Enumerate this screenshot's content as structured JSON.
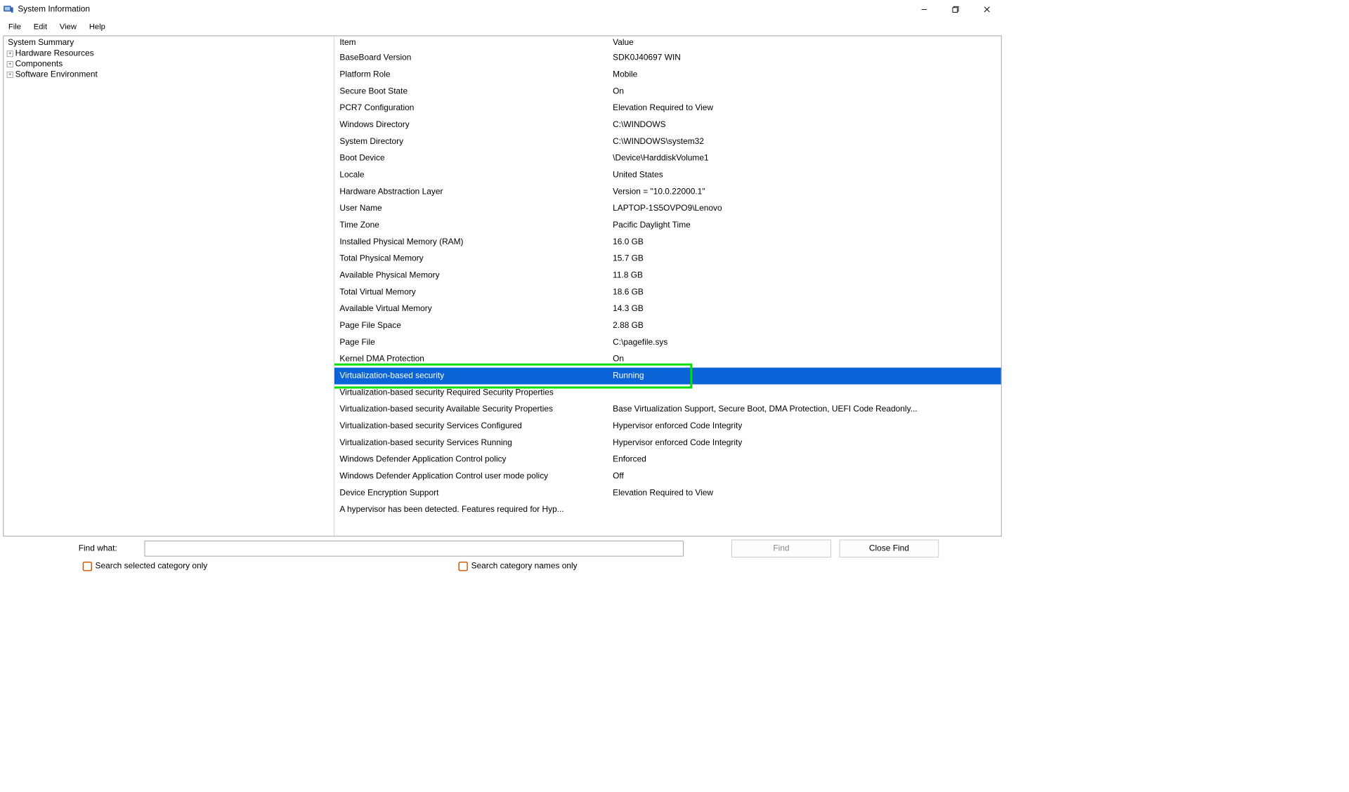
{
  "window": {
    "title": "System Information"
  },
  "menu": {
    "file": "File",
    "edit": "Edit",
    "view": "View",
    "help": "Help"
  },
  "tree": {
    "root": "System Summary",
    "nodes": [
      "Hardware Resources",
      "Components",
      "Software Environment"
    ]
  },
  "columns": {
    "item": "Item",
    "value": "Value"
  },
  "rows": [
    {
      "item": "BaseBoard Version",
      "value": "SDK0J40697 WIN"
    },
    {
      "item": "Platform Role",
      "value": "Mobile"
    },
    {
      "item": "Secure Boot State",
      "value": "On"
    },
    {
      "item": "PCR7 Configuration",
      "value": "Elevation Required to View"
    },
    {
      "item": "Windows Directory",
      "value": "C:\\WINDOWS"
    },
    {
      "item": "System Directory",
      "value": "C:\\WINDOWS\\system32"
    },
    {
      "item": "Boot Device",
      "value": "\\Device\\HarddiskVolume1"
    },
    {
      "item": "Locale",
      "value": "United States"
    },
    {
      "item": "Hardware Abstraction Layer",
      "value": "Version = \"10.0.22000.1\""
    },
    {
      "item": "User Name",
      "value": "LAPTOP-1S5OVPO9\\Lenovo"
    },
    {
      "item": "Time Zone",
      "value": "Pacific Daylight Time"
    },
    {
      "item": "Installed Physical Memory (RAM)",
      "value": "16.0 GB"
    },
    {
      "item": "Total Physical Memory",
      "value": "15.7 GB"
    },
    {
      "item": "Available Physical Memory",
      "value": "11.8 GB"
    },
    {
      "item": "Total Virtual Memory",
      "value": "18.6 GB"
    },
    {
      "item": "Available Virtual Memory",
      "value": "14.3 GB"
    },
    {
      "item": "Page File Space",
      "value": "2.88 GB"
    },
    {
      "item": "Page File",
      "value": "C:\\pagefile.sys"
    },
    {
      "item": "Kernel DMA Protection",
      "value": "On"
    },
    {
      "item": "Virtualization-based security",
      "value": "Running",
      "selected": true
    },
    {
      "item": "Virtualization-based security Required Security Properties",
      "value": ""
    },
    {
      "item": "Virtualization-based security Available Security Properties",
      "value": "Base Virtualization Support, Secure Boot, DMA Protection, UEFI Code Readonly..."
    },
    {
      "item": "Virtualization-based security Services Configured",
      "value": "Hypervisor enforced Code Integrity"
    },
    {
      "item": "Virtualization-based security Services Running",
      "value": "Hypervisor enforced Code Integrity"
    },
    {
      "item": "Windows Defender Application Control policy",
      "value": "Enforced"
    },
    {
      "item": "Windows Defender Application Control user mode policy",
      "value": "Off"
    },
    {
      "item": "Device Encryption Support",
      "value": "Elevation Required to View"
    },
    {
      "item": "A hypervisor has been detected. Features required for Hyp...",
      "value": ""
    }
  ],
  "find": {
    "label": "Find what:",
    "value": "",
    "find_btn": "Find",
    "close_btn": "Close Find",
    "chk1": "Search selected category only",
    "chk2": "Search category names only"
  }
}
